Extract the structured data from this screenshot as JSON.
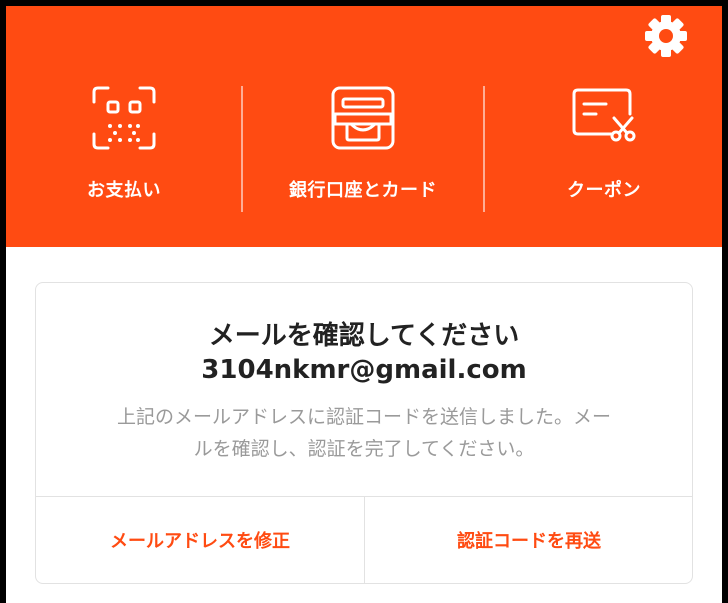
{
  "header": {
    "bg_color": "#FF4B12",
    "settings_icon": "gear-icon",
    "nav": [
      {
        "label": "お支払い",
        "icon": "qr-code-icon"
      },
      {
        "label": "銀行口座とカード",
        "icon": "wallet-icon"
      },
      {
        "label": "クーポン",
        "icon": "coupon-icon"
      }
    ]
  },
  "verify_card": {
    "title": "メールを確認してください",
    "email": "3104nkmr@gmail.com",
    "body_line1": "上記のメールアドレスに認証コードを送信しました。メー",
    "body_line2": "ルを確認し、認証を完了してください。",
    "edit_email_label": "メールアドレスを修正",
    "resend_code_label": "認証コードを再送"
  },
  "colors": {
    "accent": "#FF4B12",
    "muted_text": "#9a9a9a",
    "title_text": "#222222"
  }
}
